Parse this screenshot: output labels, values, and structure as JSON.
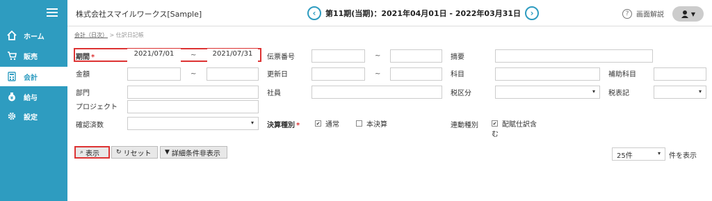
{
  "sidebar": {
    "items": [
      {
        "label": "ホーム",
        "icon": "home-icon"
      },
      {
        "label": "販売",
        "icon": "cart-icon"
      },
      {
        "label": "会計",
        "icon": "calculator-icon"
      },
      {
        "label": "給与",
        "icon": "money-bag-icon"
      },
      {
        "label": "設定",
        "icon": "gear-icon"
      }
    ]
  },
  "header": {
    "company": "株式会社スマイルワークス[Sample]",
    "period": "第11期(当期)：2021年04月01日 - 2022年03月31日",
    "help": "画面解説"
  },
  "breadcrumb": {
    "link": "会計（日次）",
    "sep": ">",
    "current": "仕訳日記帳"
  },
  "form": {
    "period_label": "期間",
    "req_mark": "*",
    "date_from": "2021/07/01",
    "date_to": "2021/07/31",
    "tilde": "~",
    "amount_label": "金額",
    "dept_label": "部門",
    "project_label": "プロジェクト",
    "confirm_label": "確認済数",
    "slip_label": "伝票番号",
    "updated_label": "更新日",
    "employee_label": "社員",
    "closing_label": "決算種別",
    "closing_normal": "通常",
    "closing_final": "本決算",
    "summary_label": "摘要",
    "account_label": "科目",
    "tax_category_label": "税区分",
    "link_type_label": "連動種別",
    "link_type_value_1": "配賦仕訳含",
    "link_type_value_2": "む",
    "sub_account_label": "補助科目",
    "tax_display_label": "税表記"
  },
  "buttons": {
    "show": "表示",
    "reset": "リセット",
    "hide_detail": "詳細条件非表示"
  },
  "paging": {
    "per_page": "25件",
    "suffix": "件を表示"
  }
}
